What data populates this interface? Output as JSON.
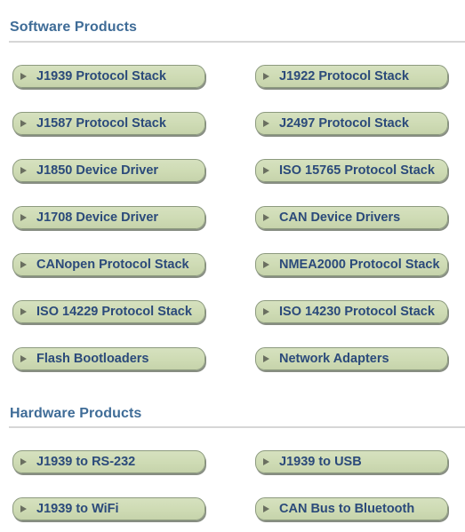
{
  "sections": [
    {
      "title": "Software Products",
      "items": [
        {
          "label": "J1939 Protocol Stack",
          "icon": "triangle-right-icon"
        },
        {
          "label": "J1922 Protocol Stack",
          "icon": "triangle-right-icon"
        },
        {
          "label": "J1587 Protocol Stack",
          "icon": "triangle-right-icon"
        },
        {
          "label": "J2497 Protocol Stack",
          "icon": "triangle-right-icon"
        },
        {
          "label": "J1850 Device Driver",
          "icon": "triangle-right-icon"
        },
        {
          "label": "ISO 15765 Protocol Stack",
          "icon": "triangle-right-icon"
        },
        {
          "label": "J1708 Device Driver",
          "icon": "triangle-right-icon"
        },
        {
          "label": "CAN Device Drivers",
          "icon": "triangle-right-icon"
        },
        {
          "label": "CANopen Protocol Stack",
          "icon": "triangle-right-icon"
        },
        {
          "label": "NMEA2000 Protocol Stack",
          "icon": "triangle-right-icon"
        },
        {
          "label": "ISO 14229 Protocol Stack",
          "icon": "triangle-right-icon"
        },
        {
          "label": "ISO 14230 Protocol Stack",
          "icon": "triangle-right-icon"
        },
        {
          "label": "Flash Bootloaders",
          "icon": "triangle-right-icon"
        },
        {
          "label": "Network Adapters",
          "icon": "triangle-right-icon"
        }
      ]
    },
    {
      "title": "Hardware Products",
      "items": [
        {
          "label": "J1939 to RS-232",
          "icon": "triangle-right-icon"
        },
        {
          "label": "J1939 to USB",
          "icon": "triangle-right-icon"
        },
        {
          "label": "J1939 to WiFi",
          "icon": "triangle-right-icon"
        },
        {
          "label": "CAN Bus to Bluetooth",
          "icon": "triangle-right-icon"
        }
      ]
    }
  ],
  "colors": {
    "section_title": "#3f6c97",
    "button_fill": "#cedbb4",
    "button_text": "#2b4a7a",
    "divider": "#d6d6d6"
  }
}
